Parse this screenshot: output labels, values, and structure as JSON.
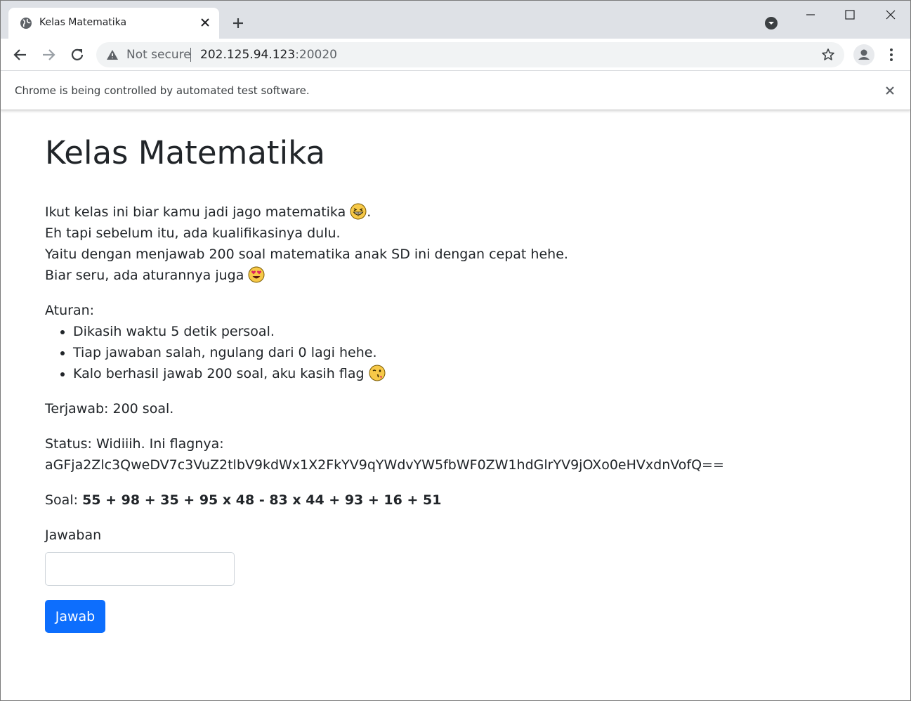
{
  "browser": {
    "tab_title": "Kelas Matematika",
    "security_label": "Not secure",
    "url_host": "202.125.94.123",
    "url_port": ":20020",
    "infobar_message": "Chrome is being controlled by automated test software."
  },
  "page": {
    "title": "Kelas Matematika",
    "intro": {
      "line1": "Ikut kelas ini biar kamu jadi jago matematika ",
      "line1_end": ".",
      "line2": "Eh tapi sebelum itu, ada kualifikasinya dulu.",
      "line3": "Yaitu dengan menjawab 200 soal matematika anak SD ini dengan cepat hehe.",
      "line4": "Biar seru, ada aturannya juga "
    },
    "rules_title": "Aturan:",
    "rules": [
      "Dikasih waktu 5 detik persoal.",
      "Tiap jawaban salah, ngulang dari 0 lagi hehe.",
      "Kalo berhasil jawab 200 soal, aku kasih flag "
    ],
    "answered": "Terjawab: 200 soal.",
    "status": "Status: Widiiih. Ini flagnya: aGFja2Zlc3QweDV7c3VuZ2tlbV9kdWx1X2FkYV9qYWdvYW5fbWF0ZW1hdGlrYV9jOXo0eHVxdnVofQ==",
    "question_label": "Soal: ",
    "question": "55 + 98 + 35 + 95 x 48 - 83 x 44 + 93 + 16 + 51",
    "answer_label": "Jawaban",
    "answer_value": "",
    "submit_label": "Jawab"
  },
  "icons": {
    "grin": "grinning-squinting-face-icon",
    "heart_eyes": "heart-eyes-face-icon",
    "wink": "winking-kiss-face-icon"
  },
  "colors": {
    "primary": "#0d6efd",
    "text": "#212529",
    "tabstrip": "#dee1e6"
  }
}
